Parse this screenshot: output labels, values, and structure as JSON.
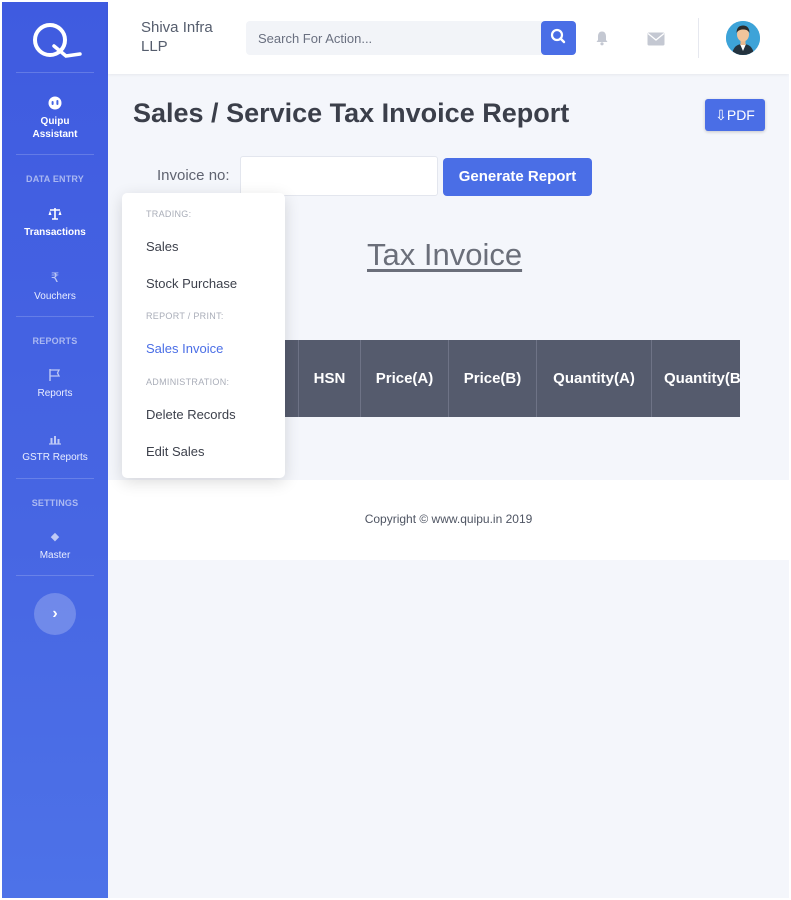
{
  "company": {
    "name": "Shiva Infra LLP"
  },
  "search": {
    "placeholder": "Search For Action..."
  },
  "sidebar": {
    "items": [
      {
        "label": "Quipu Assistant",
        "icon": "assistant-icon"
      },
      {
        "label": "Transactions",
        "icon": "scale-icon"
      },
      {
        "label": "Vouchers",
        "icon": "rupee-icon"
      },
      {
        "label": "Reports",
        "icon": "flag-icon"
      },
      {
        "label": "GSTR Reports",
        "icon": "bar-chart-icon"
      },
      {
        "label": "Master",
        "icon": "diamond-icon"
      }
    ],
    "headings": {
      "data_entry": "DATA ENTRY",
      "reports": "REPORTS",
      "settings": "SETTINGS"
    },
    "expand_icon": "›",
    "rupee_glyph": "₹",
    "master_glyph": "◆"
  },
  "page": {
    "title": "Sales / Service Tax Invoice Report",
    "pdf_button": "⇩PDF",
    "invoice_label": "Invoice no:",
    "invoice_value": "",
    "generate_button": "Generate Report",
    "doc_title": "Tax Invoice"
  },
  "table": {
    "headers": [
      "",
      "HSN",
      "Price(A)",
      "Price(B)",
      "Quantity(A)",
      "Quantity(B)"
    ]
  },
  "footer": {
    "copyright": "Copyright © www.quipu.in 2019"
  },
  "menu": {
    "sections": [
      {
        "heading": "TRADING:",
        "items": [
          "Sales",
          "Stock Purchase"
        ]
      },
      {
        "heading": "REPORT / PRINT:",
        "items": [
          "Sales Invoice"
        ]
      },
      {
        "heading": "ADMINISTRATION:",
        "items": [
          "Delete Records",
          "Edit Sales"
        ]
      }
    ],
    "active_item": "Sales Invoice"
  },
  "colors": {
    "accent": "#4a6ee6",
    "sidebar": "#4566e3",
    "table_header": "#555b6d"
  }
}
